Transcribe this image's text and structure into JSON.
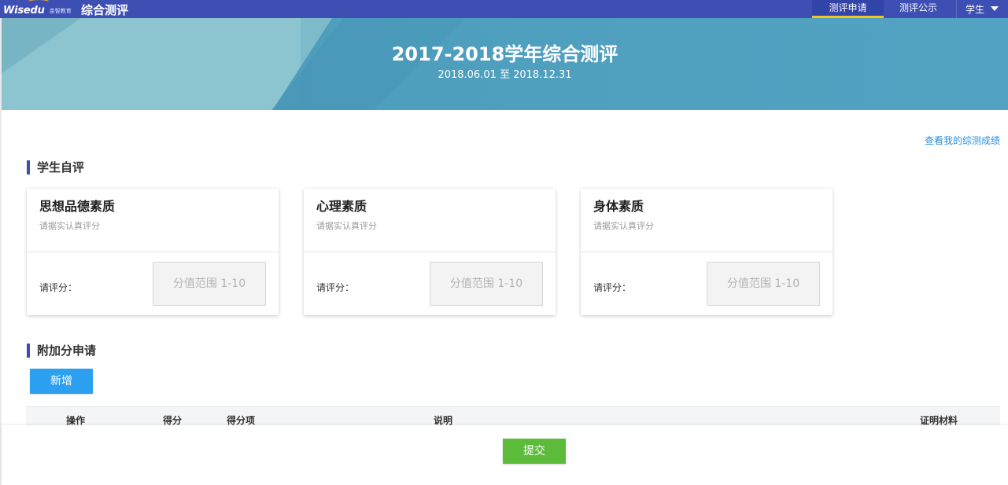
{
  "header": {
    "logo_text": "Wisedu",
    "logo_sub": "金智教育",
    "app_title": "综合测评",
    "tabs": [
      {
        "label": "测评申请",
        "active": true
      },
      {
        "label": "测评公示",
        "active": false
      }
    ],
    "role": "学生",
    "role_icon": "caret-down-icon",
    "colors": {
      "bar": "#3e4fb4",
      "active_underline": "#f5c518"
    }
  },
  "banner": {
    "title": "2017-2018学年综合测评",
    "date_range": "2018.06.01 至 2018.12.31"
  },
  "view_score_link": "查看我的综测成绩",
  "self_eval": {
    "section_title": "学生自评",
    "cards": [
      {
        "title": "思想品德素质",
        "desc": "请据实认真评分",
        "label": "请评分：",
        "placeholder": "分值范围 1-10"
      },
      {
        "title": "心理素质",
        "desc": "请据实认真评分",
        "label": "请评分：",
        "placeholder": "分值范围 1-10"
      },
      {
        "title": "身体素质",
        "desc": "请据实认真评分",
        "label": "请评分：",
        "placeholder": "分值范围 1-10"
      }
    ]
  },
  "extra": {
    "section_title": "附加分申请",
    "add_button": "新增",
    "columns": [
      "操作",
      "得分",
      "得分项",
      "说明",
      "证明材料"
    ]
  },
  "submit_button": "提交"
}
